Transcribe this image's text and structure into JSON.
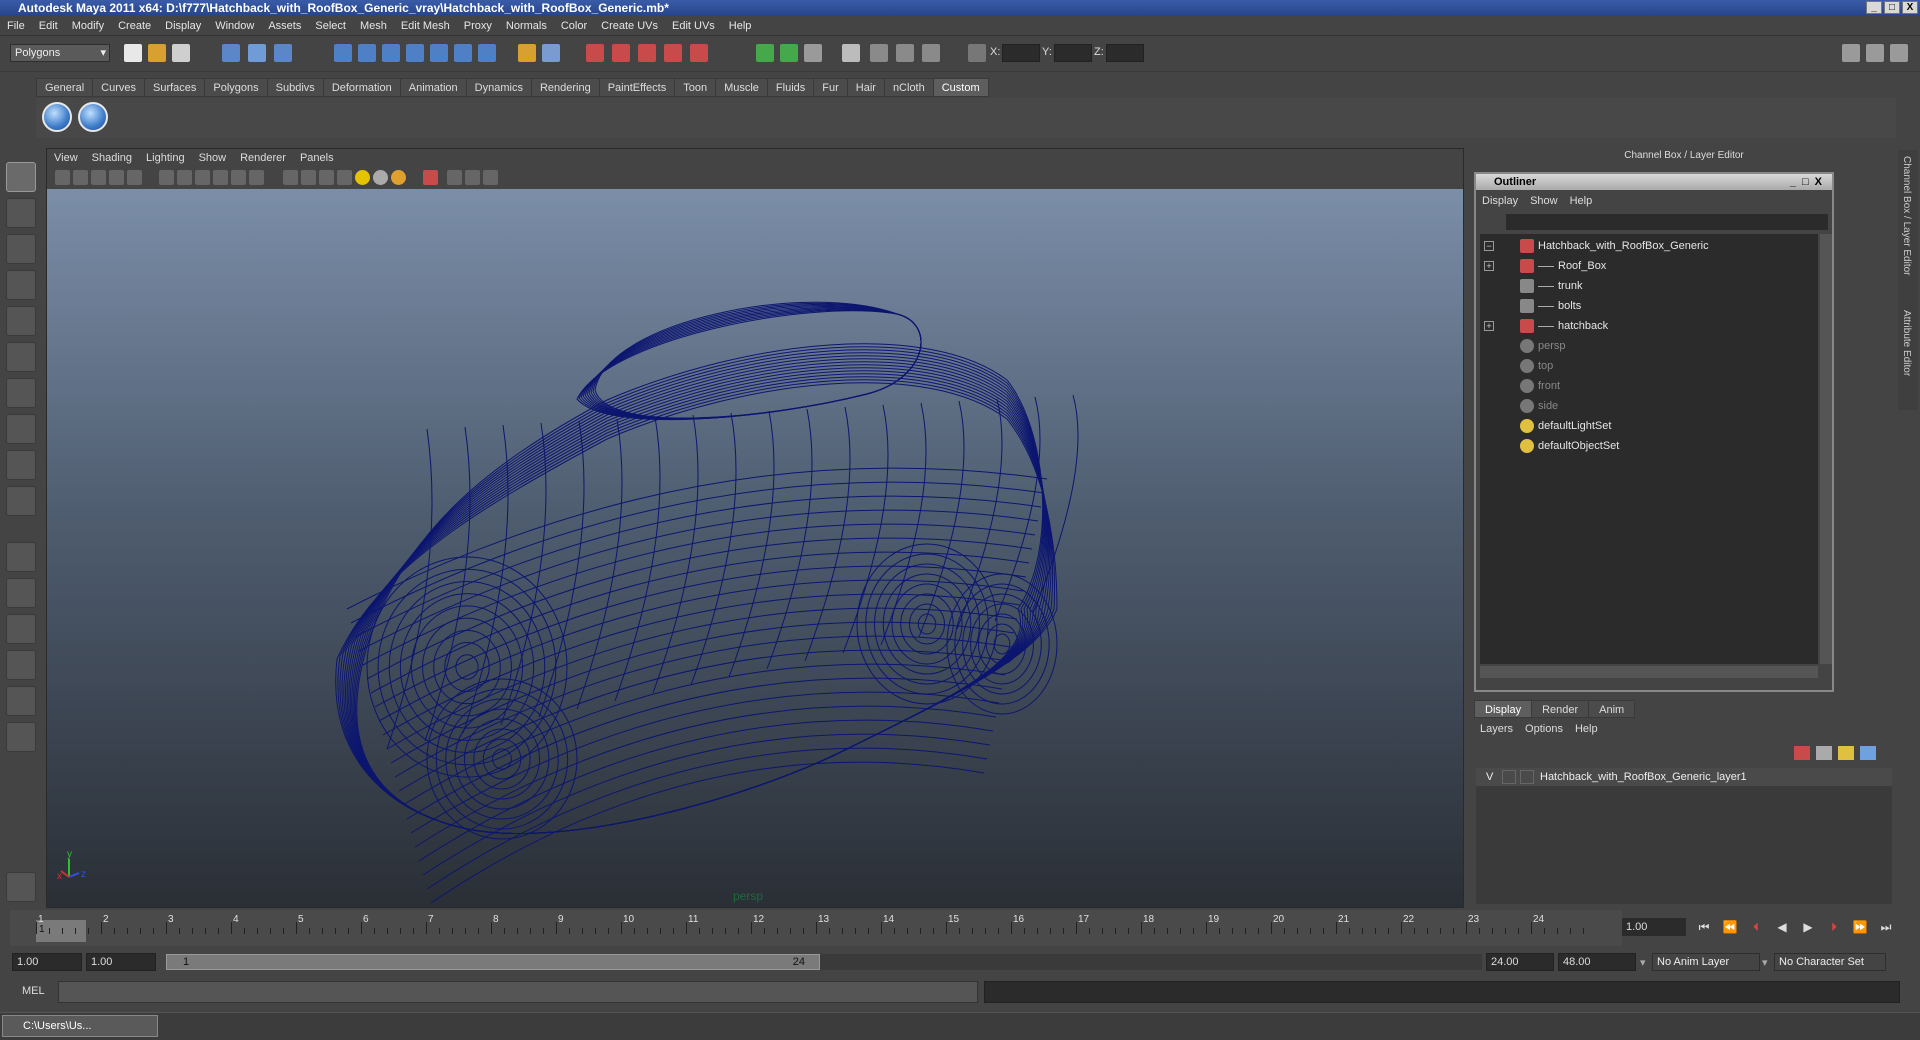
{
  "window": {
    "title": "Autodesk Maya 2011 x64: D:\\f777\\Hatchback_with_RoofBox_Generic_vray\\Hatchback_with_RoofBox_Generic.mb*",
    "min": "_",
    "max": "□",
    "close": "X"
  },
  "menubar": [
    "File",
    "Edit",
    "Modify",
    "Create",
    "Display",
    "Window",
    "Assets",
    "Select",
    "Mesh",
    "Edit Mesh",
    "Proxy",
    "Normals",
    "Color",
    "Create UVs",
    "Edit UVs",
    "Help"
  ],
  "status": {
    "mode": "Polygons",
    "x_label": "X:",
    "y_label": "Y:",
    "z_label": "Z:"
  },
  "shelf": {
    "tabs": [
      "General",
      "Curves",
      "Surfaces",
      "Polygons",
      "Subdivs",
      "Deformation",
      "Animation",
      "Dynamics",
      "Rendering",
      "PaintEffects",
      "Toon",
      "Muscle",
      "Fluids",
      "Fur",
      "Hair",
      "nCloth",
      "Custom"
    ],
    "active_tab": "Custom"
  },
  "viewport": {
    "menu": [
      "View",
      "Shading",
      "Lighting",
      "Show",
      "Renderer",
      "Panels"
    ],
    "camera": "persp",
    "axis_x": "x",
    "axis_y": "y",
    "axis_z": "z",
    "wire_color": "#0c1670"
  },
  "channelbox_title": "Channel Box / Layer Editor",
  "side_tabs": [
    "Channel Box / Layer Editor",
    "Attribute Editor"
  ],
  "outliner": {
    "title": "Outliner",
    "menu": [
      "Display",
      "Show",
      "Help"
    ],
    "items": [
      {
        "label": "Hatchback_with_RoofBox_Generic",
        "expander": "−",
        "indent": 0,
        "icon": "mesh-icon",
        "dim": false
      },
      {
        "label": "Roof_Box",
        "expander": "+",
        "indent": 1,
        "icon": "mesh-icon",
        "dim": false
      },
      {
        "label": "trunk",
        "expander": "",
        "indent": 1,
        "icon": "group-icon",
        "dim": false
      },
      {
        "label": "bolts",
        "expander": "",
        "indent": 1,
        "icon": "group-icon",
        "dim": false
      },
      {
        "label": "hatchback",
        "expander": "+",
        "indent": 1,
        "icon": "mesh-icon",
        "dim": false
      },
      {
        "label": "persp",
        "expander": "",
        "indent": 0,
        "icon": "camera-icon",
        "dim": true
      },
      {
        "label": "top",
        "expander": "",
        "indent": 0,
        "icon": "camera-icon",
        "dim": true
      },
      {
        "label": "front",
        "expander": "",
        "indent": 0,
        "icon": "camera-icon",
        "dim": true
      },
      {
        "label": "side",
        "expander": "",
        "indent": 0,
        "icon": "camera-icon",
        "dim": true
      },
      {
        "label": "defaultLightSet",
        "expander": "",
        "indent": 0,
        "icon": "set-icon",
        "dim": false
      },
      {
        "label": "defaultObjectSet",
        "expander": "",
        "indent": 0,
        "icon": "set-icon",
        "dim": false
      }
    ]
  },
  "layer_editor": {
    "tabs": [
      "Display",
      "Render",
      "Anim"
    ],
    "active_tab": "Display",
    "menu": [
      "Layers",
      "Options",
      "Help"
    ],
    "layers": [
      {
        "visible": "V",
        "name": "Hatchback_with_RoofBox_Generic_layer1"
      }
    ]
  },
  "timeline": {
    "ticks": [
      "1",
      "2",
      "3",
      "4",
      "5",
      "6",
      "7",
      "8",
      "9",
      "10",
      "11",
      "12",
      "13",
      "14",
      "15",
      "16",
      "17",
      "18",
      "19",
      "20",
      "21",
      "22",
      "23",
      "24"
    ],
    "current_marker": "1",
    "current_frame": "1.00"
  },
  "range": {
    "start": "1.00",
    "inner_start": "1.00",
    "range_start_label": "1",
    "range_end_label": "24",
    "end": "24.00",
    "outer_end": "48.00",
    "anim_layer": "No Anim Layer",
    "char_set": "No Character Set"
  },
  "command": {
    "label": "MEL"
  },
  "taskbar": {
    "item": "C:\\Users\\Us..."
  }
}
